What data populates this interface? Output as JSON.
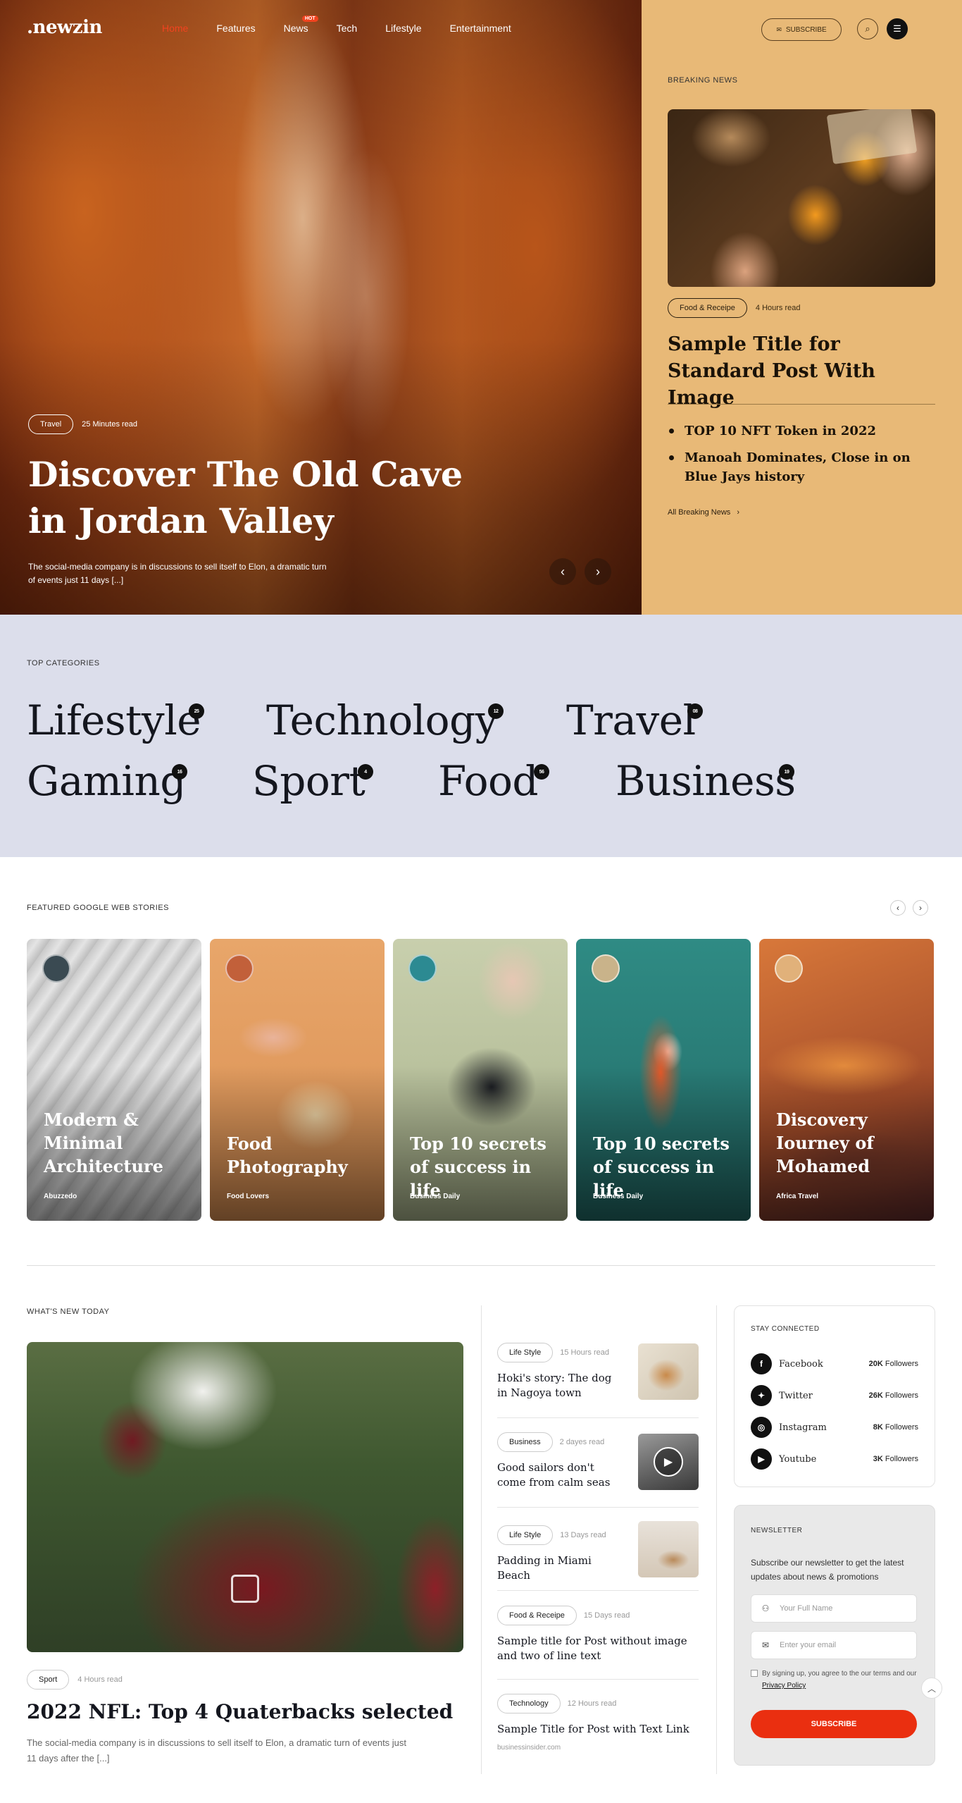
{
  "header": {
    "logo": ".newzin",
    "menu": [
      "Home",
      "Features",
      "News",
      "Tech",
      "Lifestyle",
      "Entertainment"
    ],
    "hot_badge": "HOT",
    "subscribe_label": "SUBSCRIBE"
  },
  "hero": {
    "category": "Travel",
    "read_time": "25 Minutes read",
    "title": "Discover The Old Cave in Jordan Valley",
    "description": "The social-media company is in discussions to sell itself to Elon, a dramatic turn of events just 11 days [...]"
  },
  "breaking": {
    "label": "BREAKING NEWS",
    "category": "Food & Receipe",
    "read_time": "4 Hours read",
    "title": "Sample Title for Standard Post With Image",
    "list": [
      "TOP 10 NFT Token in 2022",
      "Manoah Dominates, Close in on Blue Jays history"
    ],
    "all_link": "All Breaking News"
  },
  "categories": {
    "label": "TOP CATEGORIES",
    "items": [
      {
        "name": "Lifestyle",
        "count": "25"
      },
      {
        "name": "Technology",
        "count": "12"
      },
      {
        "name": "Travel",
        "count": "08"
      },
      {
        "name": "Gaming",
        "count": "16"
      },
      {
        "name": "Sport",
        "count": "4"
      },
      {
        "name": "Food",
        "count": "56"
      },
      {
        "name": "Business",
        "count": "19"
      }
    ]
  },
  "stories": {
    "label": "FEATURED GOOGLE WEB STORIES",
    "items": [
      {
        "title": "Modern & Minimal Architecture",
        "author": "Abuzzedo"
      },
      {
        "title": "Food Photography",
        "author": "Food Lovers"
      },
      {
        "title": "Top 10 secrets of success in life",
        "author": "Business Daily"
      },
      {
        "title": "Top 10 secrets of success in life",
        "author": "Business Daily"
      },
      {
        "title": "Discovery Iourney of Mohamed",
        "author": "Africa Travel"
      }
    ]
  },
  "whats_new": {
    "label": "WHAT'S NEW TODAY",
    "main": {
      "category": "Sport",
      "read_time": "4 Hours read",
      "title": "2022 NFL: Top 4 Quaterbacks selected",
      "description": "The social-media company is in discussions to sell itself to Elon, a dramatic turn of events just 11 days after the [...]"
    },
    "side": [
      {
        "category": "Life Style",
        "time": "15 Hours read",
        "title": "Hoki's story: The dog in Nagoya town"
      },
      {
        "category": "Business",
        "time": "2 dayes read",
        "title": "Good sailors don't come from calm seas"
      },
      {
        "category": "Life Style",
        "time": "13 Days read",
        "title": "Padding in Miami Beach"
      },
      {
        "category": "Food & Receipe",
        "time": "15 Days read",
        "title": "Sample title for Post without image and two of line text"
      },
      {
        "category": "Technology",
        "time": "12 Hours read",
        "title": "Sample Title for Post with Text Link",
        "source": "businessinsider.com"
      }
    ]
  },
  "stay_connected": {
    "label": "STAY CONNECTED",
    "items": [
      {
        "name": "Facebook",
        "count": "20K",
        "unit": "Followers"
      },
      {
        "name": "Twitter",
        "count": "26K",
        "unit": "Followers"
      },
      {
        "name": "Instagram",
        "count": "8K",
        "unit": "Followers"
      },
      {
        "name": "Youtube",
        "count": "3K",
        "unit": "Followers"
      }
    ]
  },
  "newsletter": {
    "label": "NEWSLETTER",
    "description": "Subscribe our newsletter to get the latest updates about news & promotions",
    "name_placeholder": "Your Full Name",
    "email_placeholder": "Enter your email",
    "agree_text": "By signing up, you agree to the our terms and our",
    "privacy_link": "Privacy Policy",
    "button": "SUBSCRIBE"
  },
  "colors": {
    "accent": "#ea2f10",
    "breaking_bg": "#e8b977",
    "categories_bg": "#dcdeeb"
  }
}
